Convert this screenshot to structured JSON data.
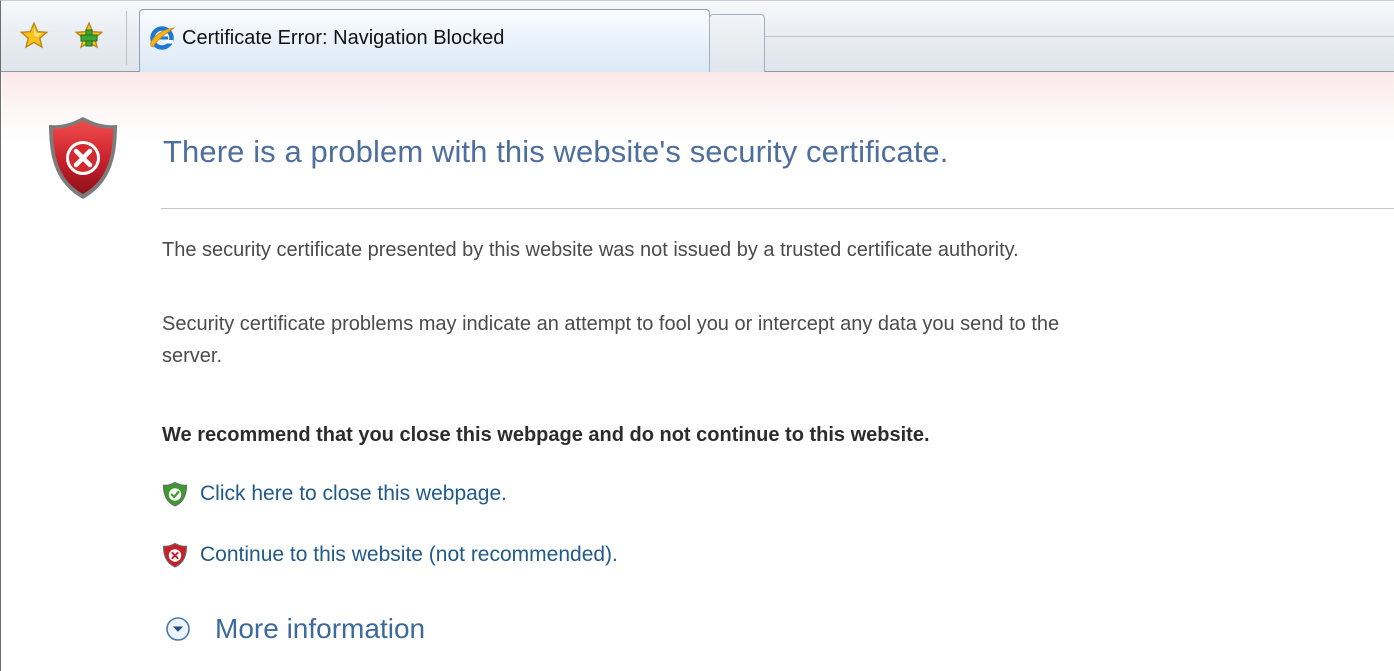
{
  "browser": {
    "tab_title": "Certificate Error: Navigation Blocked",
    "icons": {
      "favorites": "star-icon",
      "add_to_favorites": "add-favorite-icon",
      "browser": "ie-icon",
      "new_tab": "new-tab-button"
    }
  },
  "page": {
    "title": "There is a problem with this website's security certificate.",
    "paragraph1": "The security certificate presented by this website was not issued by a trusted certificate authority.",
    "paragraph2_line1": "Security certificate problems may indicate an attempt to fool you or intercept any data you send to the",
    "paragraph2_line2": "server.",
    "recommendation": "We recommend that you close this webpage and do not continue to this website.",
    "close_link": "Click here to close this webpage.",
    "continue_link": "Continue to this website (not recommended).",
    "more_info": "More information"
  },
  "colors": {
    "title": "#4e6e9c",
    "link": "#1f5a8a",
    "shield_red": "#c8202a",
    "shield_green": "#3d9a2f",
    "page_top_tint": "#fbe9e9"
  }
}
